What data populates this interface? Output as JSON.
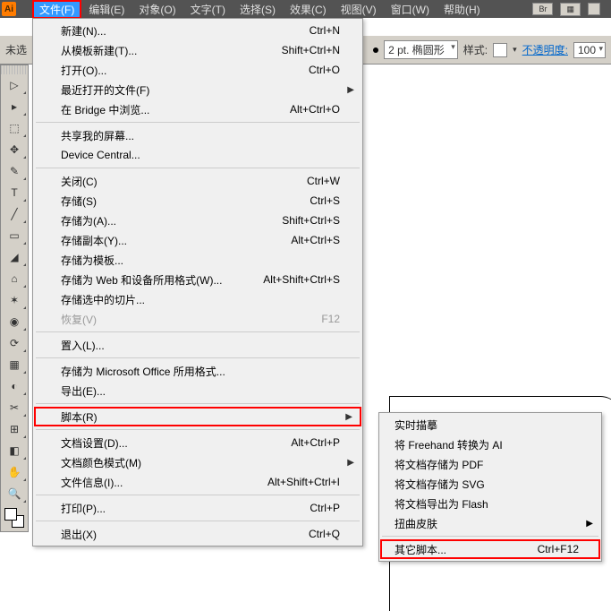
{
  "app_icon": "Ai",
  "header_buttons": [
    "Br",
    "▦"
  ],
  "menubar": [
    {
      "label": "文件(F)",
      "open": true,
      "hl": true
    },
    {
      "label": "编辑(E)"
    },
    {
      "label": "对象(O)"
    },
    {
      "label": "文字(T)"
    },
    {
      "label": "选择(S)"
    },
    {
      "label": "效果(C)"
    },
    {
      "label": "视图(V)"
    },
    {
      "label": "窗口(W)"
    },
    {
      "label": "帮助(H)"
    }
  ],
  "toolbar": {
    "left_label": "未选",
    "stroke_value": "2 pt. 椭圆形",
    "style_label": "样式:",
    "opacity_label": "不透明度:",
    "opacity_value": "100"
  },
  "file_menu": [
    {
      "label": "新建(N)...",
      "shortcut": "Ctrl+N"
    },
    {
      "label": "从模板新建(T)...",
      "shortcut": "Shift+Ctrl+N"
    },
    {
      "label": "打开(O)...",
      "shortcut": "Ctrl+O"
    },
    {
      "label": "最近打开的文件(F)",
      "sub": true
    },
    {
      "label": "在 Bridge 中浏览...",
      "shortcut": "Alt+Ctrl+O"
    },
    {
      "sep": true
    },
    {
      "label": "共享我的屏幕..."
    },
    {
      "label": "Device Central..."
    },
    {
      "sep": true
    },
    {
      "label": "关闭(C)",
      "shortcut": "Ctrl+W"
    },
    {
      "label": "存储(S)",
      "shortcut": "Ctrl+S"
    },
    {
      "label": "存储为(A)...",
      "shortcut": "Shift+Ctrl+S"
    },
    {
      "label": "存储副本(Y)...",
      "shortcut": "Alt+Ctrl+S"
    },
    {
      "label": "存储为模板..."
    },
    {
      "label": "存储为 Web 和设备所用格式(W)...",
      "shortcut": "Alt+Shift+Ctrl+S"
    },
    {
      "label": "存储选中的切片..."
    },
    {
      "label": "恢复(V)",
      "shortcut": "F12",
      "disabled": true
    },
    {
      "sep": true
    },
    {
      "label": "置入(L)..."
    },
    {
      "sep": true
    },
    {
      "label": "存储为 Microsoft Office 所用格式..."
    },
    {
      "label": "导出(E)..."
    },
    {
      "sep": true
    },
    {
      "label": "脚本(R)",
      "sub": true,
      "hl": true
    },
    {
      "sep": true
    },
    {
      "label": "文档设置(D)...",
      "shortcut": "Alt+Ctrl+P"
    },
    {
      "label": "文档颜色模式(M)",
      "sub": true
    },
    {
      "label": "文件信息(I)...",
      "shortcut": "Alt+Shift+Ctrl+I"
    },
    {
      "sep": true
    },
    {
      "label": "打印(P)...",
      "shortcut": "Ctrl+P"
    },
    {
      "sep": true
    },
    {
      "label": "退出(X)",
      "shortcut": "Ctrl+Q"
    }
  ],
  "script_submenu": [
    {
      "label": "实时描摹"
    },
    {
      "label": "将 Freehand 转换为 AI"
    },
    {
      "label": "将文档存储为 PDF"
    },
    {
      "label": "将文档存储为 SVG"
    },
    {
      "label": "将文档导出为 Flash"
    },
    {
      "label": "扭曲皮肤",
      "sub": true
    },
    {
      "sep": true
    },
    {
      "label": "其它脚本...",
      "shortcut": "Ctrl+F12",
      "hl": true
    }
  ],
  "palette_glyphs": [
    "▷",
    "▸",
    "⬚",
    "✥",
    "✎",
    "T",
    "╱",
    "▭",
    "◢",
    "⌂",
    "✶",
    "◉",
    "⟳",
    "▦",
    "◐",
    "✂",
    "⊞",
    "◧",
    "✋",
    "🔍"
  ]
}
